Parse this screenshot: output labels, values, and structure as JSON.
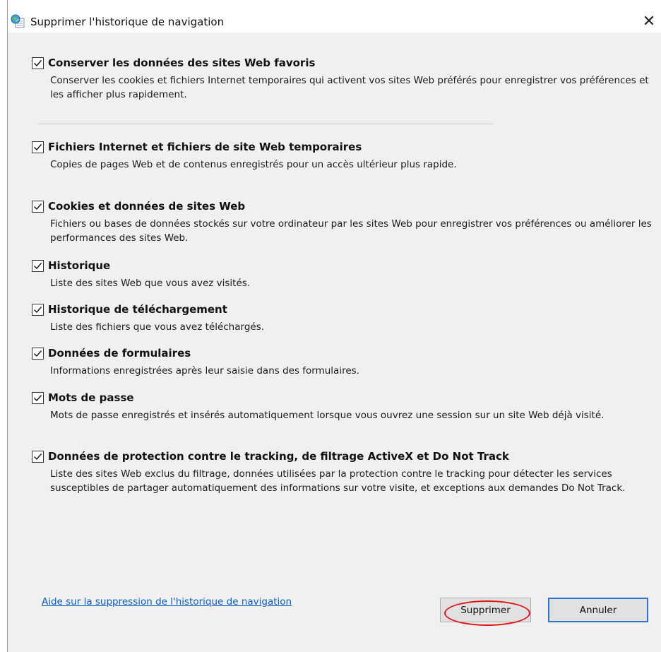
{
  "window": {
    "title": "Supprimer l'historique de navigation",
    "icon": "ie-globe-icon",
    "close_glyph": "✕"
  },
  "options": [
    {
      "checked": true,
      "title": "Conserver les données des sites Web favoris",
      "description": "Conserver les cookies et fichiers Internet temporaires qui activent vos sites Web préférés pour enregistrer vos préférences et les afficher plus rapidement."
    },
    {
      "checked": true,
      "title": "Fichiers Internet et fichiers de site Web temporaires",
      "description": "Copies de pages Web et de contenus enregistrés pour un accès ultérieur plus rapide."
    },
    {
      "checked": true,
      "title": "Cookies et données de sites Web",
      "description": "Fichiers ou bases de données stockés sur votre ordinateur par les sites Web pour enregistrer vos préférences ou améliorer les performances des sites Web."
    },
    {
      "checked": true,
      "title": "Historique",
      "description": "Liste des sites Web que vous avez visités."
    },
    {
      "checked": true,
      "title": "Historique de téléchargement",
      "description": "Liste des fichiers que vous avez téléchargés."
    },
    {
      "checked": true,
      "title": "Données de formulaires",
      "description": "Informations enregistrées après leur saisie dans des formulaires."
    },
    {
      "checked": true,
      "title": "Mots de passe",
      "description": "Mots de passe enregistrés et insérés automatiquement lorsque vous ouvrez une session sur un site Web déjà visité."
    },
    {
      "checked": true,
      "title": "Données de protection contre le tracking, de filtrage ActiveX et Do Not Track",
      "description": "Liste des sites Web exclus du filtrage, données utilisées par la protection contre le tracking pour détecter les services susceptibles de partager automatiquement des informations sur votre visite, et exceptions aux demandes Do Not Track."
    }
  ],
  "footer": {
    "help_link": "Aide sur la suppression de l'historique de navigation",
    "delete_label": "Supprimer",
    "cancel_label": "Annuler"
  },
  "colors": {
    "link": "#0a5bc4",
    "annotation": "#e01414",
    "default_button_border": "#2f74d0"
  }
}
